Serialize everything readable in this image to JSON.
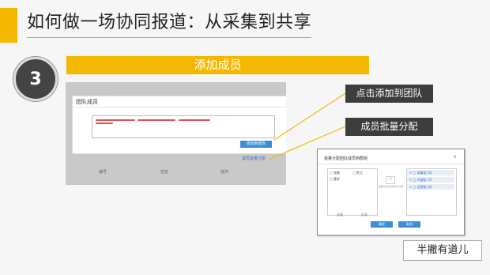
{
  "slide": {
    "title": "如何做一场协同报道：从采集到共享",
    "step_number": "3",
    "step_title": "添加成员"
  },
  "mockup_form": {
    "ghost_text": "……  ……  ……",
    "panel_title": "团队成员",
    "add_button": "添加到团队",
    "distribute_link": "成员批量分配",
    "columns": [
      "编号",
      "姓名",
      "操作"
    ]
  },
  "callouts": {
    "add_to_team": "点击添加到团队",
    "batch_assign": "成员批量分配"
  },
  "dialog": {
    "title": "批量分配团队成员到群组",
    "close": "×",
    "left_items": [
      "□ 张敏",
      "□ 陈立",
      "□ 曹轩"
    ],
    "left_footer": [
      "全选",
      "反选"
    ],
    "mid_box": "2/3",
    "mid_text": "选择小组/成员进行分组",
    "right_groups": [
      "+ □ 采集组 (0)",
      "+ □ 内容组 (0)",
      "+ □ 运营组 (0)"
    ],
    "buttons": [
      "确定",
      "取消"
    ]
  },
  "footer": {
    "brand": "半撇有道儿"
  },
  "colors": {
    "accent": "#f5b800",
    "dark": "#3d3d3d",
    "link_blue": "#3b8ed6"
  }
}
